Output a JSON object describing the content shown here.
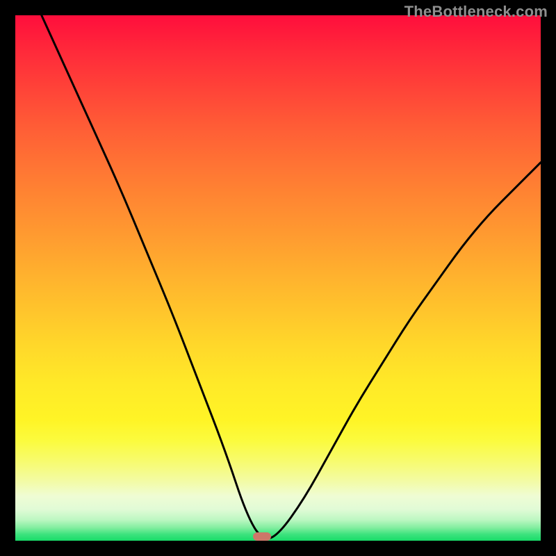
{
  "watermark": "TheBottleneck.com",
  "chart_data": {
    "type": "line",
    "title": "",
    "xlabel": "",
    "ylabel": "",
    "xlim": [
      0,
      100
    ],
    "ylim": [
      0,
      100
    ],
    "curve": {
      "min_x": 47,
      "min_y": 0,
      "points": [
        {
          "x": 5,
          "y": 100
        },
        {
          "x": 10,
          "y": 89
        },
        {
          "x": 15,
          "y": 78
        },
        {
          "x": 20,
          "y": 67
        },
        {
          "x": 25,
          "y": 55
        },
        {
          "x": 30,
          "y": 43
        },
        {
          "x": 35,
          "y": 30
        },
        {
          "x": 40,
          "y": 17
        },
        {
          "x": 44,
          "y": 5
        },
        {
          "x": 47,
          "y": 0
        },
        {
          "x": 50,
          "y": 1
        },
        {
          "x": 55,
          "y": 8
        },
        {
          "x": 60,
          "y": 17
        },
        {
          "x": 65,
          "y": 26
        },
        {
          "x": 70,
          "y": 34
        },
        {
          "x": 75,
          "y": 42
        },
        {
          "x": 80,
          "y": 49
        },
        {
          "x": 85,
          "y": 56
        },
        {
          "x": 90,
          "y": 62
        },
        {
          "x": 95,
          "y": 67
        },
        {
          "x": 100,
          "y": 72
        }
      ]
    },
    "marker": {
      "x": 47,
      "y": 0.8,
      "color": "#cd7769"
    },
    "gradient_stops": [
      {
        "pos": 0,
        "color": "#ff0e3c"
      },
      {
        "pos": 50,
        "color": "#ffb02e"
      },
      {
        "pos": 80,
        "color": "#fbfb3e"
      },
      {
        "pos": 100,
        "color": "#18db69"
      }
    ]
  }
}
